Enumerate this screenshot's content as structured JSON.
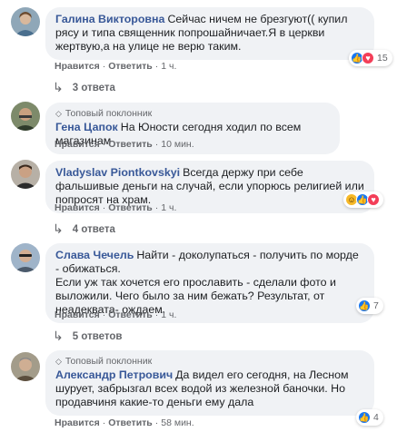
{
  "actions": {
    "like": "Нравится",
    "reply": "Ответить"
  },
  "badge": "Топовый поклонник",
  "comments": [
    {
      "author": "Галина Викторовна",
      "text": "Сейчас ничем не брезгуют(( купил рясу и типа священник попрошайничает.Я в церкви жертвую,а на улице не верю таким.",
      "time": "1 ч.",
      "reaction_count": "15",
      "replies": "3 ответа"
    },
    {
      "author": "Гена Цапок",
      "text": "На Юности сегодня ходил по всем магазинам",
      "time": "10 мин."
    },
    {
      "author": "Vladyslav Piontkovskyi",
      "text": "Всегда держу при себе фальшивые деньги на случай, если упорюсь религией или попросят на храм.",
      "time": "1 ч.",
      "replies": "4 ответа"
    },
    {
      "author": "Слава Чечель",
      "text": "Найти - доколупаться - получить по морде - обижаться.\nЕсли уж так хочется его прославить - сделали фото и выложили. Чего было за ним бежать? Результат, от неадеквата- ождаем.",
      "time": "1 ч.",
      "reaction_count": "7",
      "replies": "5 ответов"
    },
    {
      "author": "Александр Петрович",
      "text": "Да видел его сегодня, на Лесном шурует, забрызгал всех водой из железной баночки. Но продавчиня какие-то деньги ему дала",
      "time": "58 мин.",
      "reaction_count": "4"
    }
  ],
  "colors": {
    "author": "#385898",
    "bubble": "#f0f2f5",
    "meta": "#65676b",
    "like": "#1877f2"
  }
}
